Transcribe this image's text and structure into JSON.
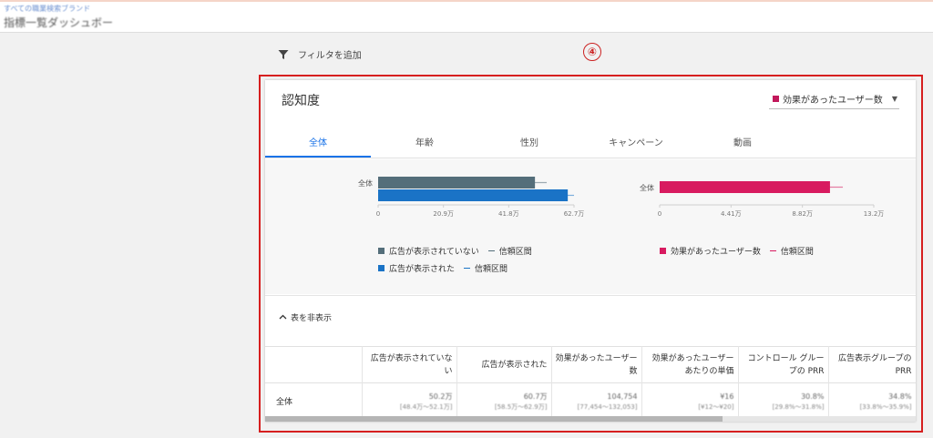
{
  "header": {
    "breadcrumb": "すべての職業検索ブランド",
    "title": "指標一覧ダッシュボー"
  },
  "toolbar": {
    "add_filter_label": "フィルタを追加"
  },
  "annotation": {
    "marker": "④",
    "color": "#d61f1f"
  },
  "card": {
    "title": "認知度",
    "metric_select": {
      "value": "効果があったユーザー数",
      "color": "#c2185b"
    },
    "tabs": [
      {
        "label": "全体",
        "active": true
      },
      {
        "label": "年齢",
        "active": false
      },
      {
        "label": "性別",
        "active": false
      },
      {
        "label": "キャンペーン",
        "active": false
      },
      {
        "label": "動画",
        "active": false
      }
    ],
    "chart_data": [
      {
        "type": "bar",
        "categories": [
          "全体"
        ],
        "series": [
          {
            "name": "広告が表示されていない",
            "values": [
              50.2
            ],
            "color": "#546e7a"
          },
          {
            "name": "広告が表示された",
            "values": [
              60.7
            ],
            "color": "#1a73c6"
          }
        ],
        "x_ticks": [
          "0",
          "20.9万",
          "41.8万",
          "62.7万"
        ],
        "xlim": [
          0,
          62.7
        ],
        "unit": "万",
        "confidence_label": "信頼区間"
      },
      {
        "type": "bar",
        "categories": [
          "全体"
        ],
        "series": [
          {
            "name": "効果があったユーザー数",
            "values": [
              10.5
            ],
            "color": "#d81b60"
          }
        ],
        "x_ticks": [
          "0",
          "4.41万",
          "8.82万",
          "13.2万"
        ],
        "xlim": [
          0,
          13.2
        ],
        "unit": "万",
        "confidence_label": "信頼区間"
      }
    ],
    "table_toggle": "表を非表示",
    "table": {
      "columns": [
        "",
        "広告が表示されていない",
        "広告が表示された",
        "効果があったユーザー数",
        "効果があったユーザーあたりの単価",
        "コントロール グループの PRR",
        "広告表示グループの PRR"
      ],
      "rows": [
        {
          "label": "全体",
          "cells": [
            {
              "value": "50.2万",
              "ci": "[48.4万〜52.1万]"
            },
            {
              "value": "60.7万",
              "ci": "[58.5万〜62.9万]"
            },
            {
              "value": "104,754",
              "ci": "[77,454〜132,053]"
            },
            {
              "value": "¥16",
              "ci": "[¥12〜¥20]"
            },
            {
              "value": "30.8%",
              "ci": "[29.8%〜31.8%]"
            },
            {
              "value": "34.8%",
              "ci": "[33.8%〜35.9%]"
            }
          ]
        }
      ]
    }
  }
}
